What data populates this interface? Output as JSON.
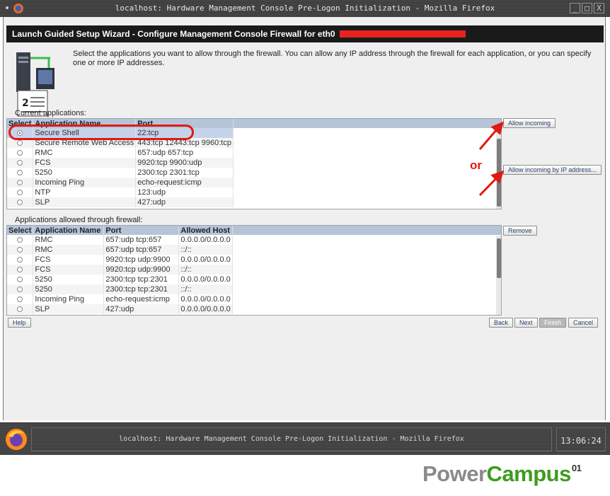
{
  "window": {
    "title": "localhost: Hardware Management Console Pre-Logon Initialization - Mozilla Firefox",
    "minimize_glyph": "_",
    "maximize_glyph": "□",
    "close_glyph": "X"
  },
  "banner": {
    "title": "Launch Guided Setup Wizard - Configure Management Console Firewall for eth0",
    "redaction_color": "#e8231e"
  },
  "intro": {
    "text": "Select the applications you want to allow through the firewall. You can allow any IP address through the firewall for each application, or you can specify one or more IP addresses.",
    "icon": "network-servers-icon"
  },
  "current": {
    "label": "Current applications:",
    "columns": [
      "Select",
      "Application Name",
      "Port"
    ],
    "rows": [
      {
        "name": "Secure Shell",
        "port": "22:tcp",
        "selected": true
      },
      {
        "name": "Secure Remote Web Access",
        "port": "443:tcp 12443:tcp 9960:tcp",
        "selected": false
      },
      {
        "name": "RMC",
        "port": "657:udp 657:tcp",
        "selected": false
      },
      {
        "name": "FCS",
        "port": "9920:tcp 9900:udp",
        "selected": false
      },
      {
        "name": "5250",
        "port": "2300:tcp 2301:tcp",
        "selected": false
      },
      {
        "name": "Incoming Ping",
        "port": "echo-request:icmp",
        "selected": false
      },
      {
        "name": "NTP",
        "port": "123:udp",
        "selected": false
      },
      {
        "name": "SLP",
        "port": "427:udp",
        "selected": false
      }
    ],
    "buttons": {
      "allow_incoming": "Allow incoming",
      "allow_by_ip": "Allow incoming by IP address..."
    }
  },
  "allowed": {
    "label": "Applications allowed through firewall:",
    "columns": [
      "Select",
      "Application Name",
      "Port",
      "Allowed Host"
    ],
    "rows": [
      {
        "name": "RMC",
        "port": "657:udp tcp:657",
        "host": "0.0.0.0/0.0.0.0"
      },
      {
        "name": "RMC",
        "port": "657:udp tcp:657",
        "host": "::/::"
      },
      {
        "name": "FCS",
        "port": "9920:tcp udp:9900",
        "host": "0.0.0.0/0.0.0.0"
      },
      {
        "name": "FCS",
        "port": "9920:tcp udp:9900",
        "host": "::/::"
      },
      {
        "name": "5250",
        "port": "2300:tcp tcp:2301",
        "host": "0.0.0.0/0.0.0.0"
      },
      {
        "name": "5250",
        "port": "2300:tcp tcp:2301",
        "host": "::/::"
      },
      {
        "name": "Incoming Ping",
        "port": "echo-request:icmp",
        "host": "0.0.0.0/0.0.0.0"
      },
      {
        "name": "SLP",
        "port": "427:udp",
        "host": "0.0.0.0/0.0.0.0"
      }
    ],
    "buttons": {
      "remove": "Remove"
    }
  },
  "footer_buttons": {
    "help": "Help",
    "back": "Back",
    "next": "Next",
    "finish": "Finish",
    "cancel": "Cancel"
  },
  "annotation": {
    "or_text": "or",
    "color": "#e01a12"
  },
  "taskbar": {
    "task_title": "localhost: Hardware Management Console Pre-Logon Initialization - Mozilla Firefox",
    "clock": "13:06:24"
  },
  "brand": {
    "part1": "Power",
    "part2": "Campus",
    "part3": "01"
  }
}
